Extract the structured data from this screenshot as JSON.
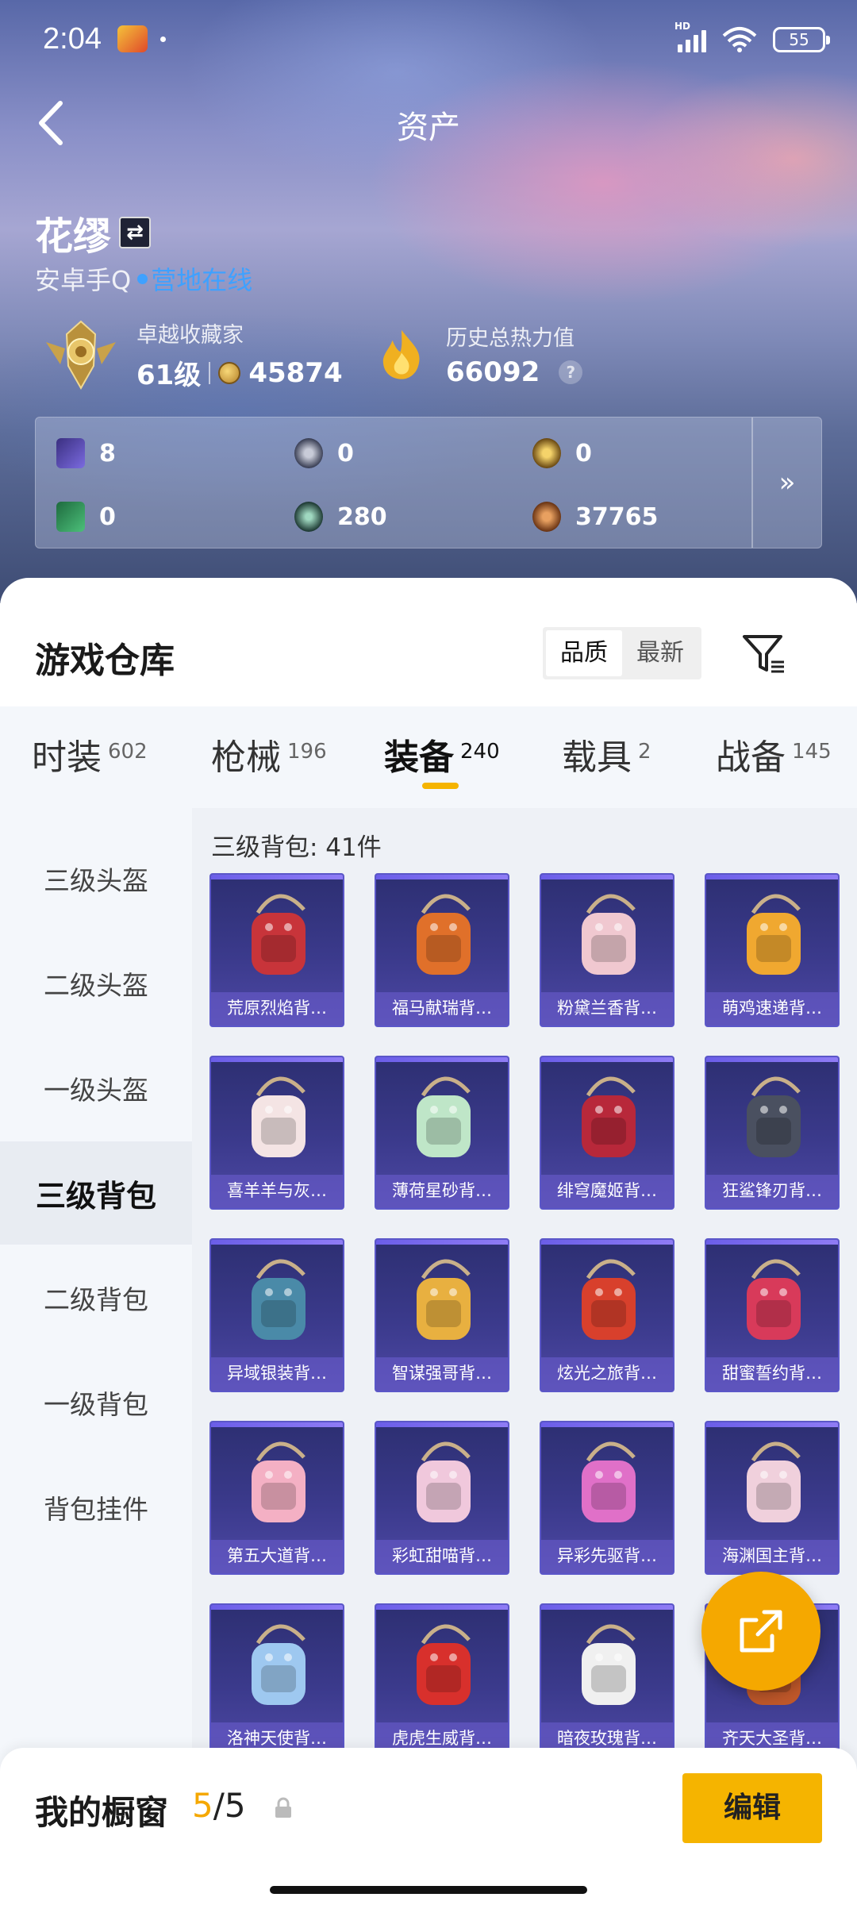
{
  "status_bar": {
    "time": "2:04",
    "app_icon_label": "和平精英",
    "network": "HD",
    "battery": "55"
  },
  "header": {
    "title": "资产",
    "back_icon": "chevron-left-icon"
  },
  "profile": {
    "name": "花缪",
    "platform": "安卓手Q",
    "online_status": "营地在线",
    "collector": {
      "label": "卓越收藏家",
      "level": "61级",
      "coins": "45874"
    },
    "heat": {
      "label": "历史总热力值",
      "value": "66092",
      "help": "?"
    }
  },
  "currencies": [
    {
      "name": "purple-ticket-icon",
      "value": "8",
      "color": "#5a4fb0"
    },
    {
      "name": "silver-badge-icon",
      "value": "0",
      "color": "#7a7f94"
    },
    {
      "name": "gold-badge-icon",
      "value": "0",
      "color": "#c79a2c"
    },
    {
      "name": "green-ticket-icon",
      "value": "0",
      "color": "#2f9a5a"
    },
    {
      "name": "green-orb-icon",
      "value": "280",
      "color": "#3c7a66"
    },
    {
      "name": "bronze-coin-icon",
      "value": "37765",
      "color": "#b0662a"
    }
  ],
  "warehouse": {
    "title": "游戏仓库",
    "sort": {
      "quality": "品质",
      "newest": "最新",
      "selected": "品质"
    },
    "tabs": [
      {
        "label": "时装",
        "count": "602"
      },
      {
        "label": "枪械",
        "count": "196"
      },
      {
        "label": "装备",
        "count": "240"
      },
      {
        "label": "载具",
        "count": "2"
      },
      {
        "label": "战备",
        "count": "145"
      }
    ],
    "active_tab": "装备",
    "categories": [
      "三级头盔",
      "二级头盔",
      "一级头盔",
      "三级背包",
      "二级背包",
      "一级背包",
      "背包挂件"
    ],
    "active_category": "三级背包",
    "grid_header": "三级背包: 41件",
    "items": [
      {
        "name": "荒原烈焰背…",
        "color": "#c8343a"
      },
      {
        "name": "福马献瑞背…",
        "color": "#e0702a"
      },
      {
        "name": "粉黛兰香背…",
        "color": "#f0c8d0"
      },
      {
        "name": "萌鸡速递背…",
        "color": "#f0a830"
      },
      {
        "name": "喜羊羊与灰…",
        "color": "#f4e4e4"
      },
      {
        "name": "薄荷星砂背…",
        "color": "#bfe6c8"
      },
      {
        "name": "绯穹魔姬背…",
        "color": "#b8283a"
      },
      {
        "name": "狂鲨锋刃背…",
        "color": "#4a5060"
      },
      {
        "name": "异域银装背…",
        "color": "#4a8aa8"
      },
      {
        "name": "智谋强哥背…",
        "color": "#e8b040"
      },
      {
        "name": "炫光之旅背…",
        "color": "#d8402c"
      },
      {
        "name": "甜蜜誓约背…",
        "color": "#d83a5a"
      },
      {
        "name": "第五大道背…",
        "color": "#f4b0c4"
      },
      {
        "name": "彩虹甜喵背…",
        "color": "#f0c8dc"
      },
      {
        "name": "异彩先驱背…",
        "color": "#e070c8"
      },
      {
        "name": "海渊国主背…",
        "color": "#f0d0dc"
      },
      {
        "name": "洛神天使背…",
        "color": "#9ec8f0"
      },
      {
        "name": "虎虎生威背…",
        "color": "#d8302c"
      },
      {
        "name": "暗夜玫瑰背…",
        "color": "#f0f0f0"
      },
      {
        "name": "齐天大圣背…",
        "color": "#c0582a"
      }
    ]
  },
  "bottom_bar": {
    "label": "我的橱窗",
    "current": "5",
    "total": "/5",
    "edit_label": "编辑"
  },
  "accent_color": "#f5b400"
}
